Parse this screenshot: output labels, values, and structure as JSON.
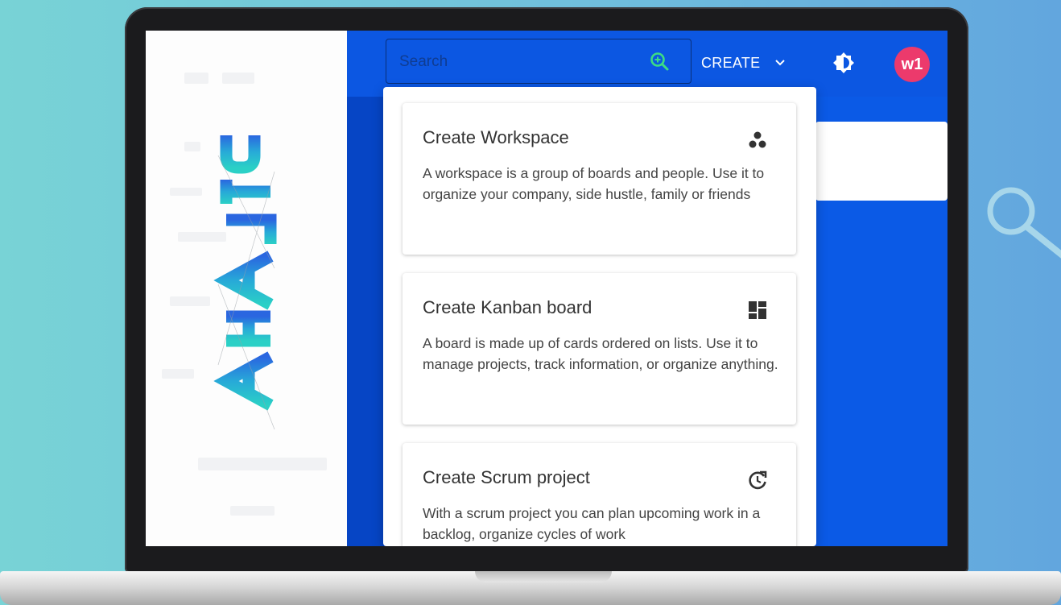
{
  "topbar": {
    "search_placeholder": "Search",
    "create_label": "CREATE",
    "avatar_initials": "w1"
  },
  "dropdown": {
    "items": [
      {
        "title": "Create Workspace",
        "description": "A workspace is a group of boards and people. Use it to organize your company, side hustle, family or friends",
        "icon": "workspace-icon"
      },
      {
        "title": "Create Kanban board",
        "description": "A board is made up of cards ordered on lists. Use it to manage projects, track information, or organize anything.",
        "icon": "dashboard-icon"
      },
      {
        "title": "Create Scrum project",
        "description": "With a scrum project you can plan upcoming work in a backlog, organize cycles of work",
        "icon": "refresh-cycle-icon"
      }
    ]
  },
  "colors": {
    "topbar_bg": "#0c57e2",
    "main_bg": "#0b5ae6",
    "avatar_bg": "#ec3a6c",
    "search_icon": "#3ddc84",
    "page_bg_left": "#78d3d6",
    "page_bg_right": "#62a6de"
  }
}
